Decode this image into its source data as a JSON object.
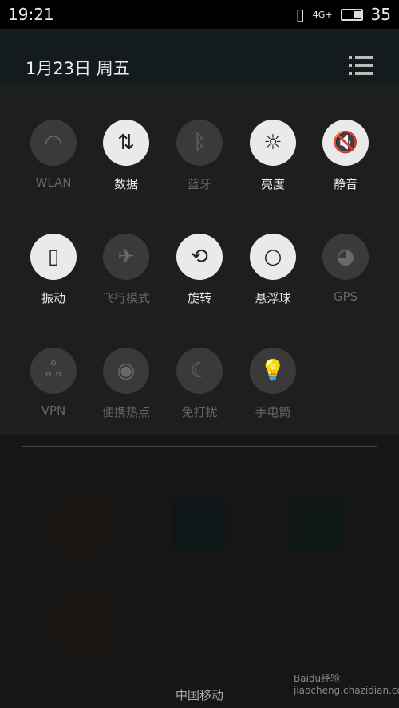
{
  "status_bar": {
    "time": "19:21",
    "network": "4G+",
    "battery": "35"
  },
  "header": {
    "date": "1月23日  周五"
  },
  "toggles": [
    {
      "label": "WLAN",
      "icon": "wifi-icon",
      "on": false,
      "glyph": "◠"
    },
    {
      "label": "数据",
      "icon": "data-arrows-icon",
      "on": true,
      "glyph": "⇅"
    },
    {
      "label": "蓝牙",
      "icon": "bluetooth-icon",
      "on": false,
      "glyph": "ᛒ"
    },
    {
      "label": "亮度",
      "icon": "brightness-auto-icon",
      "on": true,
      "glyph": "☼"
    },
    {
      "label": "静音",
      "icon": "mute-icon",
      "on": true,
      "glyph": "🔇"
    },
    {
      "label": "振动",
      "icon": "vibrate-icon",
      "on": true,
      "glyph": "▯"
    },
    {
      "label": "飞行模式",
      "icon": "airplane-icon",
      "on": false,
      "glyph": "✈"
    },
    {
      "label": "旋转",
      "icon": "rotate-icon",
      "on": true,
      "glyph": "⟲"
    },
    {
      "label": "悬浮球",
      "icon": "floating-ball-icon",
      "on": true,
      "glyph": "○"
    },
    {
      "label": "GPS",
      "icon": "gps-icon",
      "on": false,
      "glyph": "◕"
    },
    {
      "label": "VPN",
      "icon": "vpn-icon",
      "on": false,
      "glyph": "ஃ"
    },
    {
      "label": "便携热点",
      "icon": "hotspot-icon",
      "on": false,
      "glyph": "◉"
    },
    {
      "label": "免打扰",
      "icon": "moon-icon",
      "on": false,
      "glyph": "☾"
    },
    {
      "label": "手电筒",
      "icon": "flashlight-icon",
      "on": false,
      "glyph": "💡"
    }
  ],
  "carrier": "中国移动",
  "watermark": "Baidu经验 jiaocheng.chazidian.com"
}
